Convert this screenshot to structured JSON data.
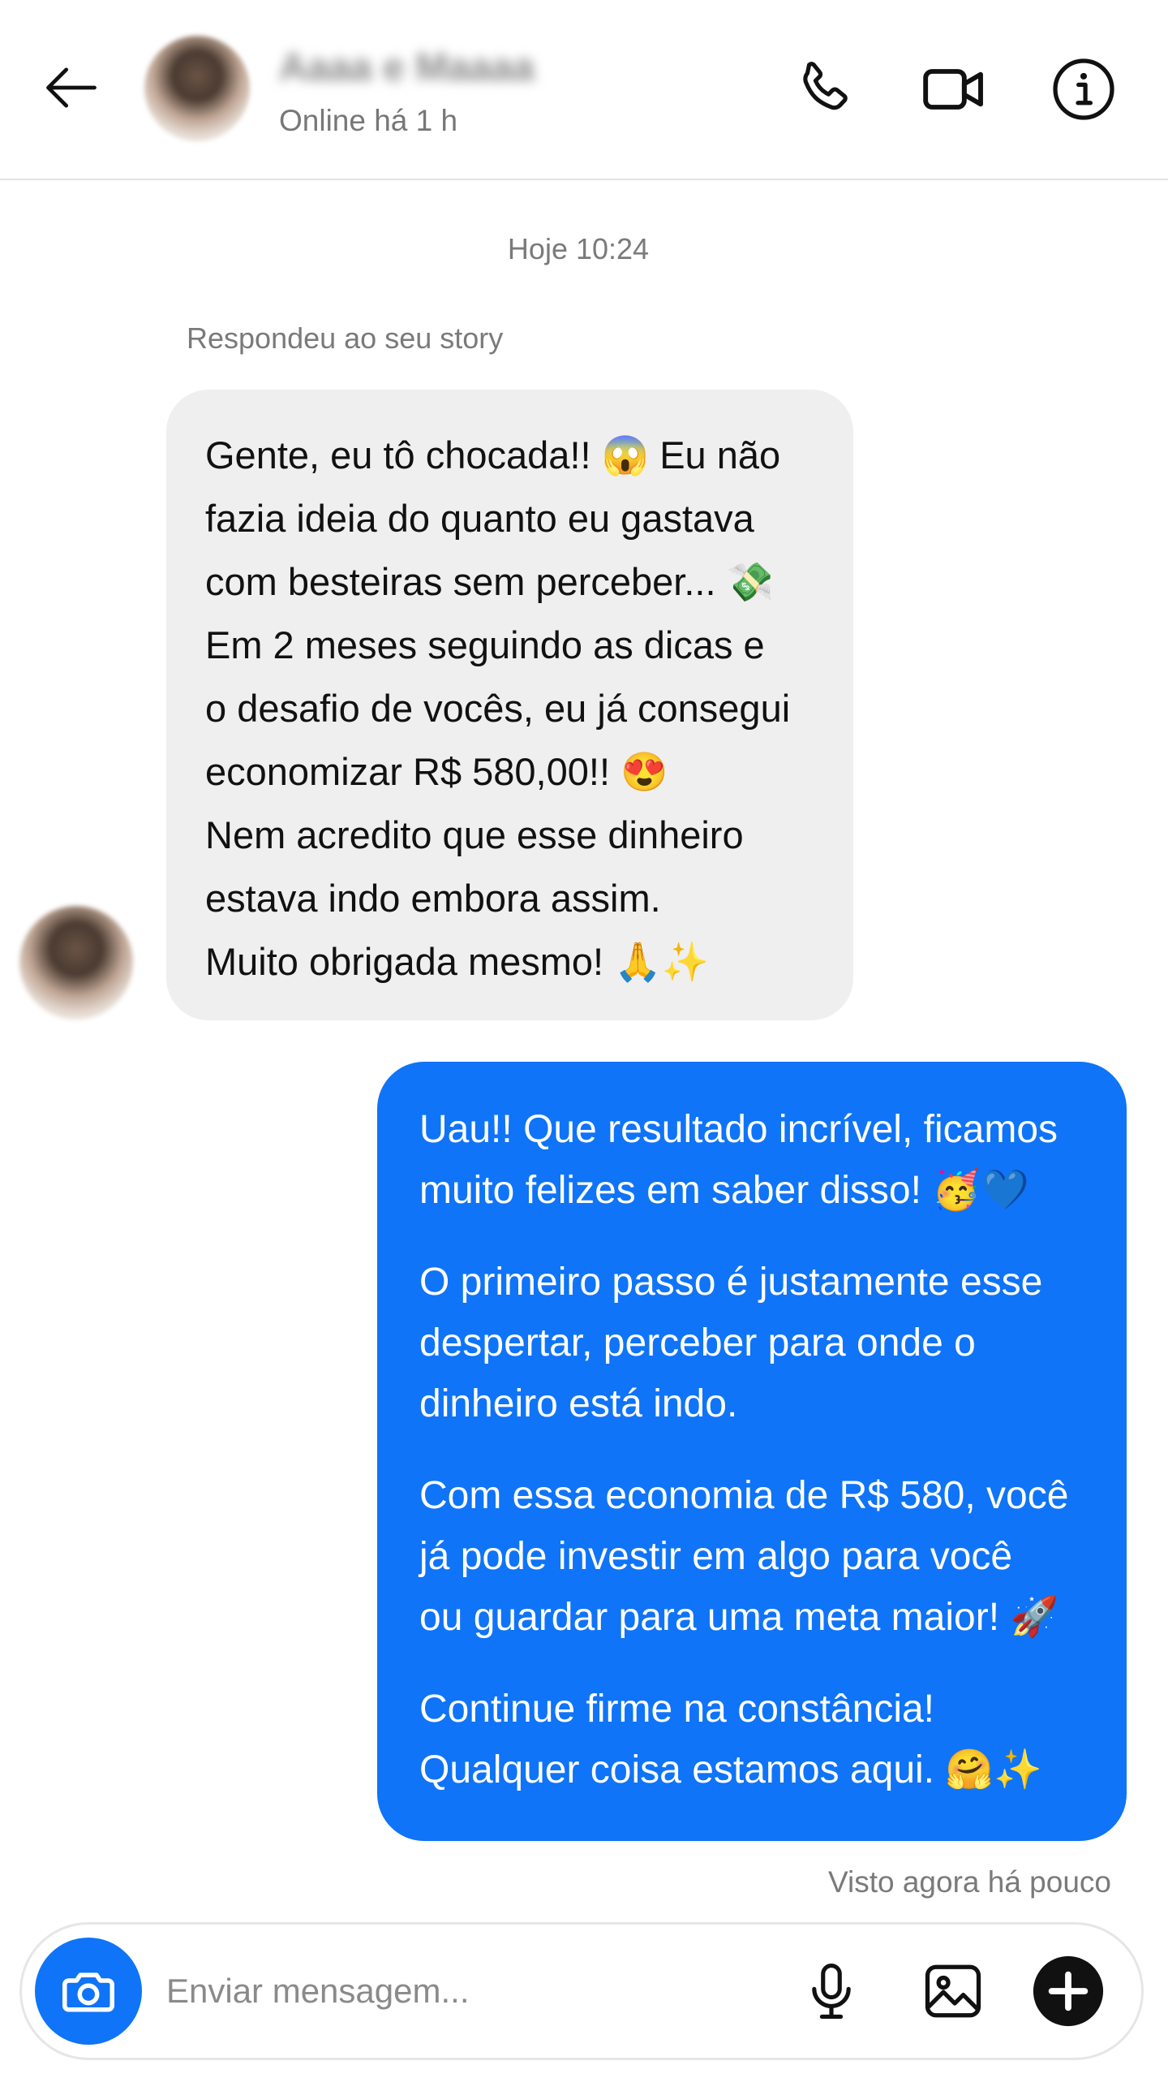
{
  "header": {
    "contact_name": "Aaaa e Maaaa",
    "status": "Online há 1 h"
  },
  "icons": {
    "back": "arrow-left-icon",
    "call": "phone-icon",
    "video": "video-camera-icon",
    "info": "info-icon",
    "camera": "camera-icon",
    "mic": "microphone-icon",
    "gallery": "image-icon",
    "add": "plus-icon"
  },
  "colors": {
    "outgoing_bubble": "#0f74f7",
    "incoming_bubble": "#efefef",
    "camera_button": "#0f74f7",
    "plus_button": "#111111"
  },
  "conversation": {
    "timestamp": "Hoje 10:24",
    "story_reply_label": "Respondeu ao seu story",
    "incoming_message": {
      "lines": [
        "Gente, eu tô chocada!! 😱 Eu não",
        "fazia ideia do quanto eu gastava",
        "com besteiras sem perceber... 💸",
        "Em 2 meses seguindo as dicas e",
        "o desafio de vocês, eu já consegui",
        "economizar R$ 580,00!! 😍",
        "Nem acredito que esse dinheiro",
        "estava indo embora assim.",
        "Muito obrigada mesmo! 🙏✨"
      ]
    },
    "outgoing_message": {
      "paragraphs": [
        {
          "lines": [
            "Uau!! Que resultado incrível, ficamos",
            "muito felizes em saber disso! 🥳💙"
          ]
        },
        {
          "lines": [
            "O primeiro passo é justamente esse",
            "despertar, perceber para onde o",
            "dinheiro está indo."
          ]
        },
        {
          "lines": [
            "Com essa economia de R$ 580, você",
            "já pode investir em algo para você",
            "ou guardar para uma meta maior! 🚀"
          ]
        },
        {
          "lines": [
            "Continue firme na constância!",
            "Qualquer coisa estamos aqui. 🤗✨"
          ]
        }
      ]
    },
    "seen_status": "Visto agora há pouco"
  },
  "composer": {
    "placeholder": "Enviar mensagem..."
  }
}
